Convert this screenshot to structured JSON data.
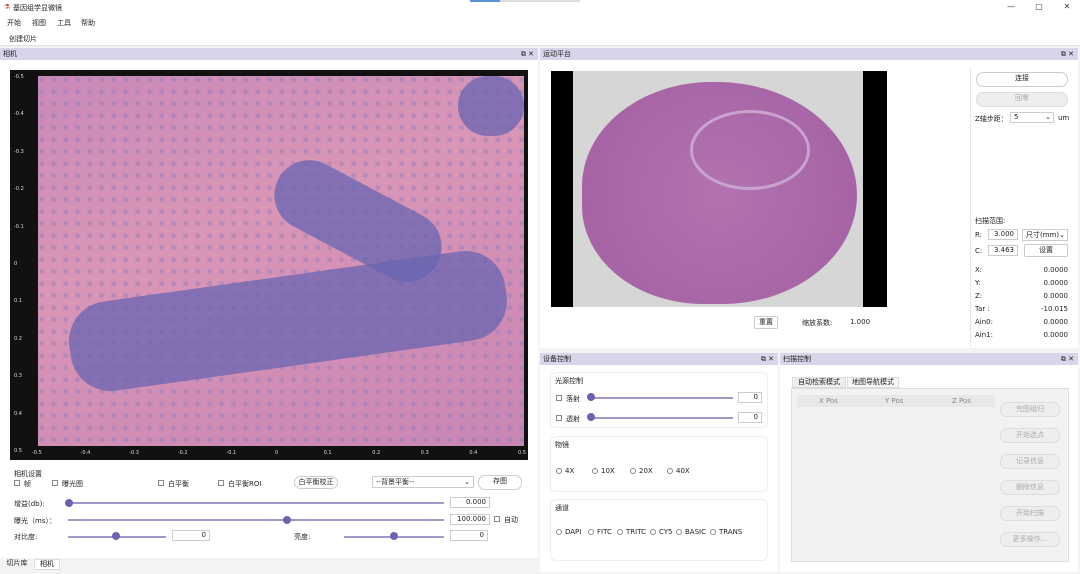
{
  "window": {
    "title": "基因组学显微镜",
    "min": "—",
    "max": "▢",
    "close": "✕"
  },
  "menu": [
    "开始",
    "视图",
    "工具",
    "帮助"
  ],
  "toolbar": {
    "create_slice": "创建切片"
  },
  "camera_panel": {
    "title": "相机",
    "y_ticks": [
      "-0.5",
      "-0.4",
      "-0.3",
      "-0.2",
      "-0.1",
      "0",
      "0.1",
      "0.2",
      "0.3",
      "0.4",
      "0.5"
    ],
    "x_ticks": [
      "-0.5",
      "-0.4",
      "-0.3",
      "-0.2",
      "-0.1",
      "0",
      "0.1",
      "0.2",
      "0.3",
      "0.4",
      "0.5"
    ],
    "settings_label": "相机设置",
    "cb_frame": "帧",
    "cb_exposure": "曝光图",
    "cb_white": "白平衡",
    "cb_white_roi": "白平衡ROI",
    "btn_white_correct": "白平衡校正",
    "bg_select": "--背景平衡--",
    "btn_save": "存图",
    "gain_label": "增益(db):",
    "gain_value": "0.000",
    "exposure_label": "曝光（ms）：",
    "exposure_value": "100.000",
    "auto_label": "自动",
    "contrast_label": "对比度:",
    "contrast_value": "0",
    "brightness_label": "亮度:",
    "brightness_value": "0"
  },
  "bottom_tabs": [
    "切片库",
    "相机"
  ],
  "stage_panel": {
    "title": "运动平台",
    "btn_connect": "连接",
    "btn_home": "回零",
    "z_step_label": "Z轴步距：",
    "z_step_value": "5",
    "z_unit": "um",
    "reset_label": "重置",
    "zoom_label": "缩放系数:",
    "zoom_value": "1.000",
    "scan_range_label": "扫描范围:",
    "r_label": "R:",
    "r_value": "3.000",
    "size_select": "尺寸(mm)",
    "c_label": "C:",
    "c_value": "3.463",
    "btn_set": "设置",
    "readouts": [
      {
        "label": "X:",
        "value": "0.0000"
      },
      {
        "label": "Y:",
        "value": "0.0000"
      },
      {
        "label": "Z:",
        "value": "0.0000"
      },
      {
        "label": "Tar :",
        "value": "-10.015"
      },
      {
        "label": "Ain0:",
        "value": "0.0000"
      },
      {
        "label": "Ain1:",
        "value": "0.0000"
      }
    ]
  },
  "device_panel": {
    "title": "设备控制",
    "light_group": "光源控制",
    "reflect_label": "落射",
    "reflect_value": "0",
    "trans_label": "透射",
    "trans_value": "0",
    "objective_group": "物镜",
    "objectives": [
      "4X",
      "10X",
      "20X",
      "40X"
    ],
    "channel_group": "通道",
    "channels": [
      "DAPI",
      "FITC",
      "TRITC",
      "CY5",
      "BASIC",
      "TRANS"
    ]
  },
  "scan_panel": {
    "title": "扫描控制",
    "tabs": [
      "自动检索模式",
      "地图导航模式"
    ],
    "columns": [
      "X Pos",
      "Y Pos",
      "Z Pos"
    ],
    "buttons": [
      "完图组归",
      "开始选点",
      "记录信息",
      "删除信息",
      "开始扫描",
      "更多操作..."
    ]
  },
  "colors": {
    "accent": "#6a64b0",
    "panel_header": "#d8d4ea"
  }
}
